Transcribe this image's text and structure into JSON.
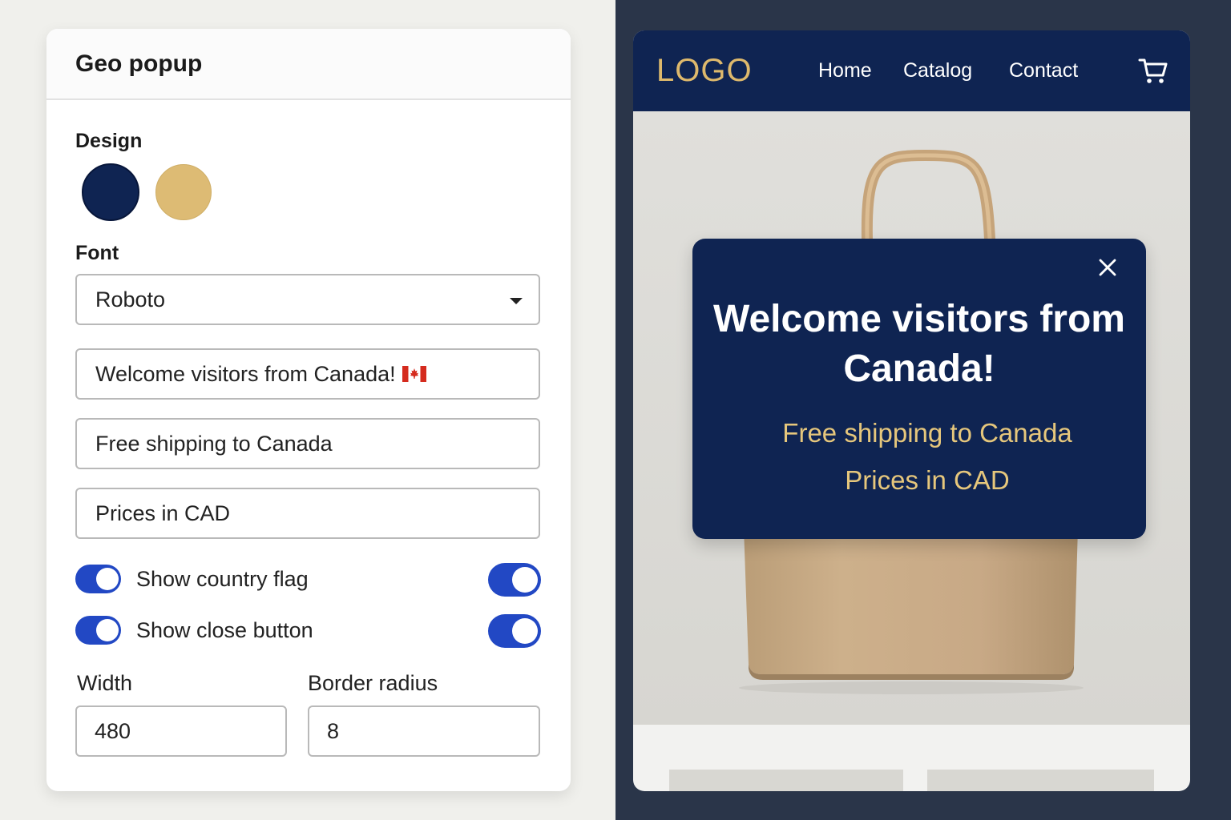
{
  "editor": {
    "title": "Geo popup",
    "design_label": "Design",
    "swatches": [
      {
        "name": "navy",
        "color": "#0f2452"
      },
      {
        "name": "gold",
        "color": "#ddbb74"
      }
    ],
    "font_label": "Font",
    "font_value": "Roboto",
    "headline_value": "Welcome visitors from Canada!",
    "headline_flag_icon": "canada-flag-icon",
    "line1_value": "Free shipping to Canada",
    "line2_value": "Prices in CAD",
    "toggles": [
      {
        "label": "Show country flag",
        "on": true
      },
      {
        "label": "Show close button",
        "on": true
      }
    ],
    "width_label": "Width",
    "width_value": "480",
    "radius_label": "Border radius",
    "radius_value": "8"
  },
  "store": {
    "logo": "LOGO",
    "nav": [
      "Home",
      "Catalog",
      "Contact"
    ],
    "cart_icon": "cart-icon",
    "hero_image": "tote-bag-photo"
  },
  "popup": {
    "title": "Welcome visitors from Canada!",
    "line1": "Free shipping to Canada",
    "line2": "Prices in CAD",
    "close_icon": "close-icon"
  },
  "colors": {
    "accent_blue": "#2248c4",
    "navy": "#0f2452",
    "gold": "#e6c77c",
    "right_background": "#2a3549"
  }
}
